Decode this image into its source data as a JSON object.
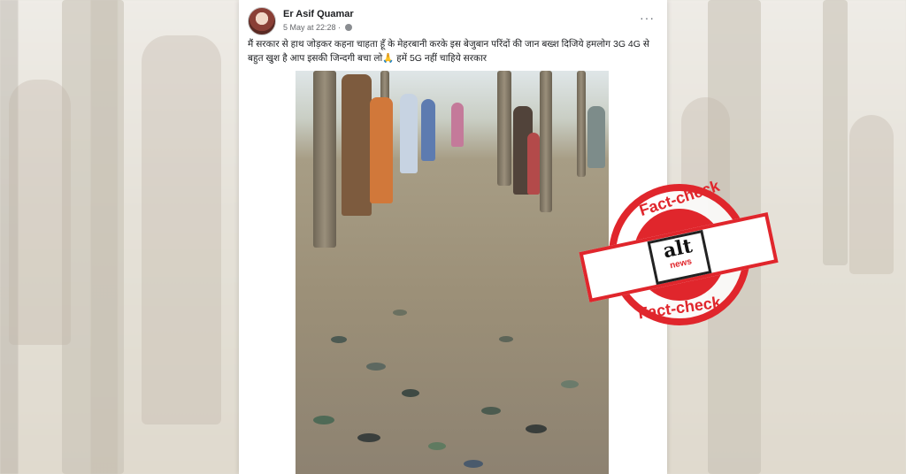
{
  "post": {
    "author": "Er Asif Quamar",
    "timestamp": "5 May at 22:28 ·",
    "more_icon": "···",
    "text": "मैं सरकार से हाथ जोड़कर कहना चाहता हूँ के मेहरबानी करके इस बेजुबान परिंदों की जान बख्श दिजिये हमलोग 3G 4G से बहुत खुश है आप इसकी जिन्दगी बचा लो🙏 हमें 5G नहीं चाहिये सरकार"
  },
  "stamp": {
    "top_label": "Fact-check",
    "bottom_label": "Fact-check",
    "logo_main": "alt",
    "logo_sub": "news",
    "color": "#e0262c"
  },
  "icons": [
    "globe-icon",
    "more-options-icon"
  ]
}
